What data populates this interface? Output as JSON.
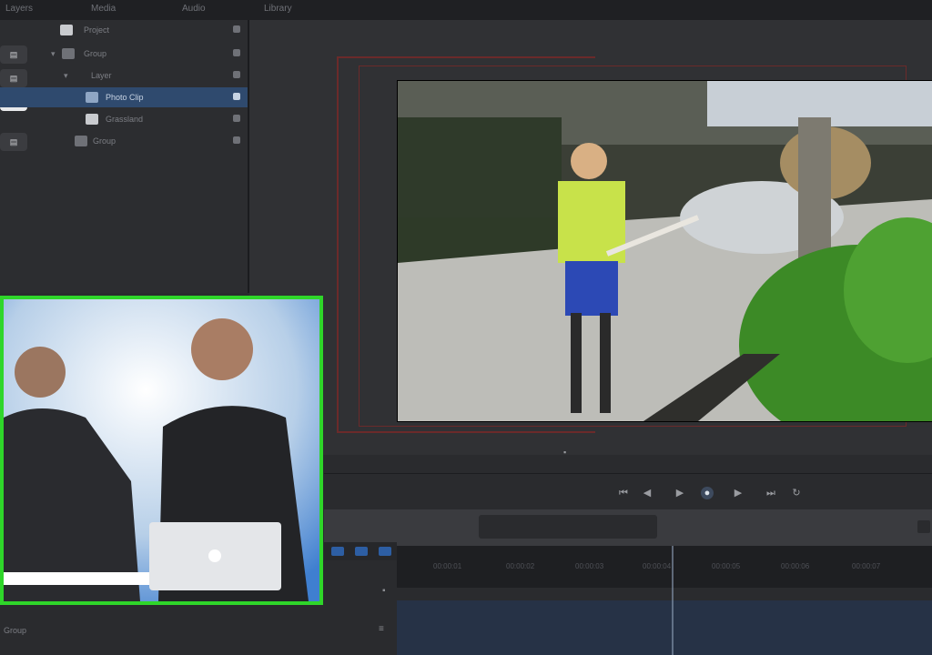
{
  "menu": {
    "items": [
      "Layers",
      "Media",
      "Audio",
      "Library"
    ]
  },
  "layers": {
    "rows": [
      {
        "name": "Project"
      },
      {
        "name": "Group"
      },
      {
        "name": "Layer"
      },
      {
        "name": "Photo Clip"
      },
      {
        "name": "Grassland"
      },
      {
        "name": "Group"
      }
    ]
  },
  "bottom": {
    "label": "Group"
  },
  "timeline": {
    "ticks": [
      "00:00:01",
      "00:00:02",
      "00:00:03",
      "00:00:04",
      "00:00:05",
      "00:00:06",
      "00:00:07",
      "00:00:08"
    ]
  },
  "transport": {
    "icons": [
      "go-to-start-icon",
      "play-back-icon",
      "play-icon",
      "play-forward-icon",
      "go-to-end-icon",
      "loop-icon",
      "mute-icon"
    ]
  },
  "colors": {
    "accent_green": "#2fd62a",
    "selection_blue": "#2f4a6e",
    "frame_red": "#6b2a2a"
  }
}
